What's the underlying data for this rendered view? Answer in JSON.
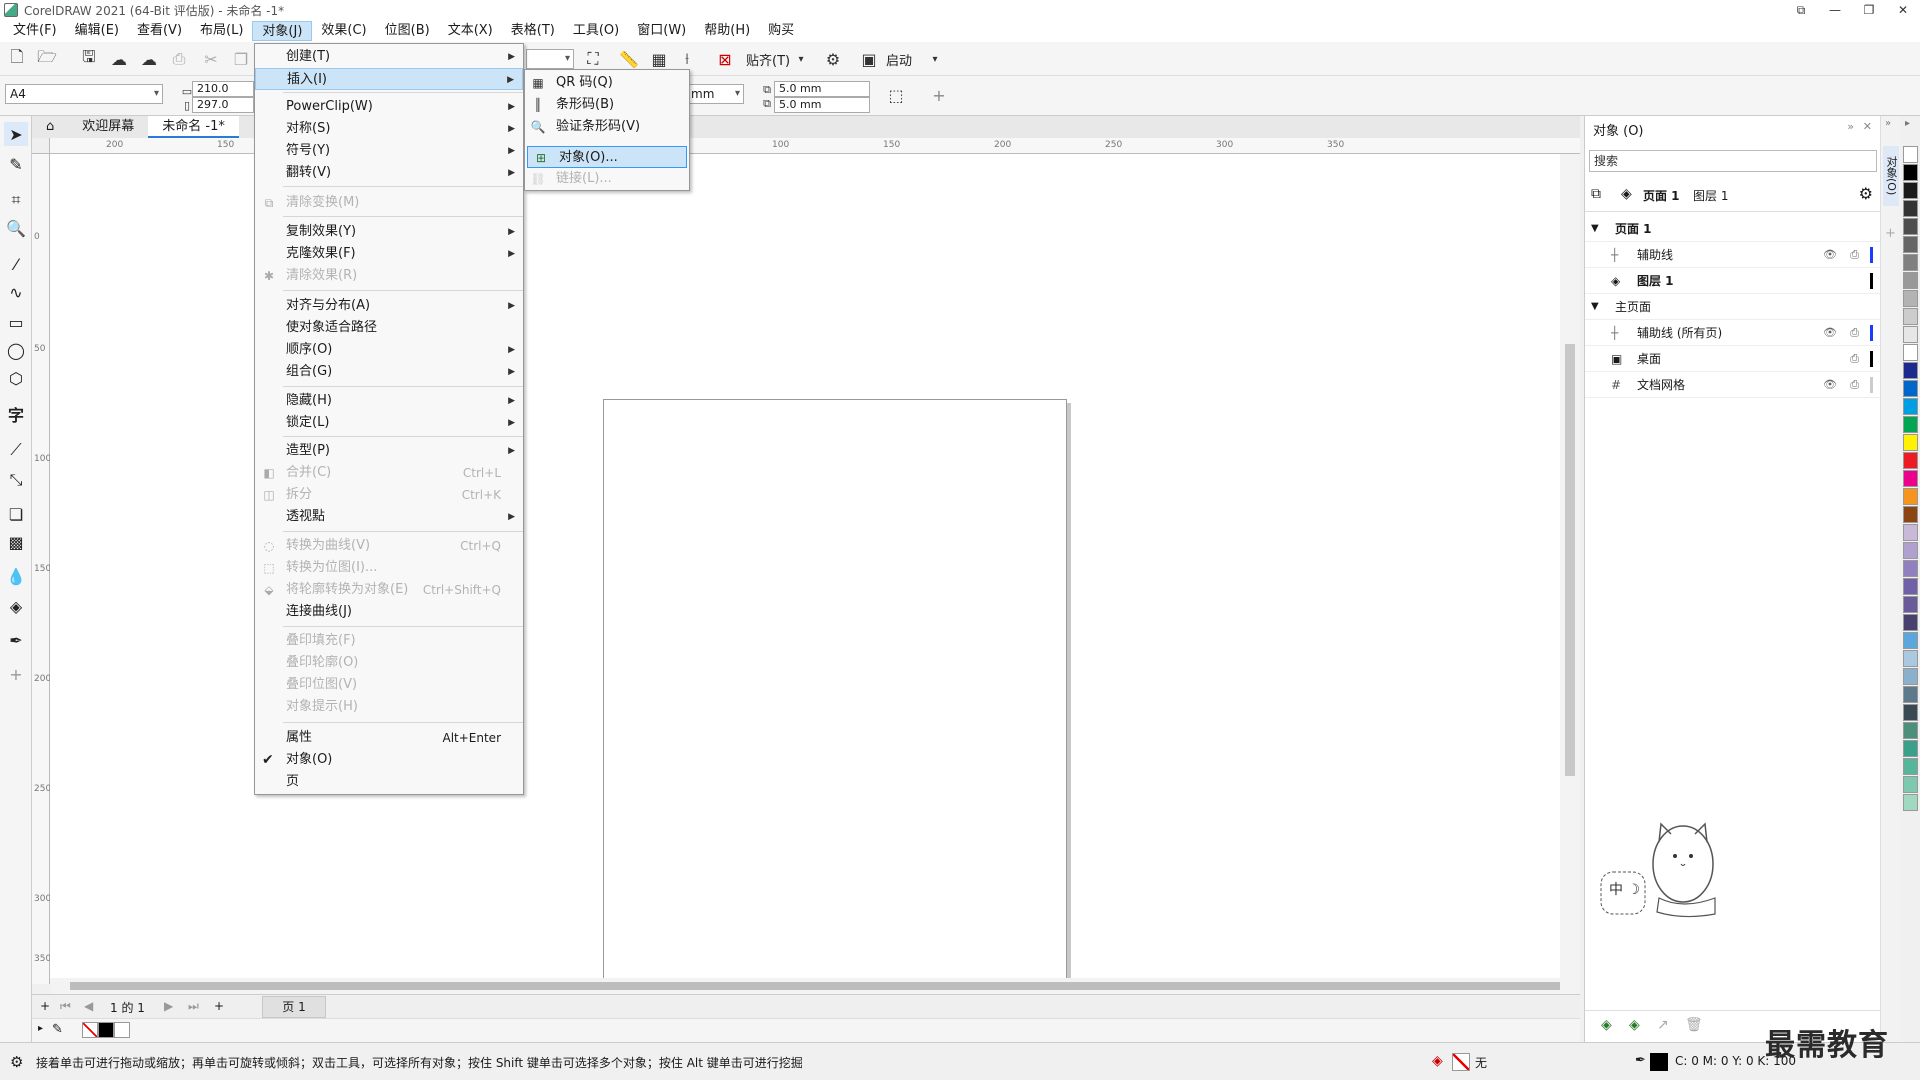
{
  "window": {
    "title": "CorelDRAW 2021 (64-Bit 评估版) - 未命名 -1*",
    "min": "—",
    "restore": "❐",
    "close": "✕",
    "help_ctl": "⧉"
  },
  "menubar": [
    {
      "label": "文件(F)"
    },
    {
      "label": "编辑(E)"
    },
    {
      "label": "查看(V)"
    },
    {
      "label": "布局(L)"
    },
    {
      "label": "对象(J)"
    },
    {
      "label": "效果(C)"
    },
    {
      "label": "位图(B)"
    },
    {
      "label": "文本(X)"
    },
    {
      "label": "表格(T)"
    },
    {
      "label": "工具(O)"
    },
    {
      "label": "窗口(W)"
    },
    {
      "label": "帮助(H)"
    },
    {
      "label": "购买"
    }
  ],
  "toolbar": {
    "snap_label": "贴齐(T)",
    "launch_label": "启动"
  },
  "propbar": {
    "page_size": "A4",
    "width": "210.0 mm",
    "height": "297.0 mm",
    "units": "mm",
    "dup_x": "5.0 mm",
    "dup_y": "5.0 mm"
  },
  "doctabs": {
    "welcome": "欢迎屏幕",
    "doc": "未命名 -1*"
  },
  "ruler": {
    "h_ticks": [
      "200",
      "150",
      "100",
      "150",
      "200",
      "250",
      "300",
      "350"
    ],
    "v_ticks": [
      "0",
      "50",
      "100",
      "150",
      "200",
      "250",
      "300",
      "350"
    ]
  },
  "object_menu": {
    "items": [
      {
        "label": "创建(T)",
        "sub": true
      },
      {
        "label": "插入(I)",
        "sub": true,
        "highlight": true
      },
      {
        "label": "PowerClip(W)",
        "sub": true
      },
      {
        "label": "对称(S)",
        "sub": true
      },
      {
        "label": "符号(Y)",
        "sub": true
      },
      {
        "label": "翻转(V)",
        "sub": true
      },
      {
        "label": "清除变换(M)",
        "disabled": true
      },
      {
        "label": "复制效果(Y)",
        "sub": true
      },
      {
        "label": "克隆效果(F)",
        "sub": true
      },
      {
        "label": "清除效果(R)",
        "disabled": true
      },
      {
        "label": "对齐与分布(A)",
        "sub": true
      },
      {
        "label": "使对象适合路径"
      },
      {
        "label": "顺序(O)",
        "sub": true
      },
      {
        "label": "组合(G)",
        "sub": true
      },
      {
        "label": "隐藏(H)",
        "sub": true
      },
      {
        "label": "锁定(L)",
        "sub": true
      },
      {
        "label": "造型(P)",
        "sub": true
      },
      {
        "label": "合并(C)",
        "shortcut": "Ctrl+L",
        "disabled": true
      },
      {
        "label": "拆分",
        "shortcut": "Ctrl+K",
        "disabled": true
      },
      {
        "label": "透视點",
        "sub": true
      },
      {
        "label": "转换为曲线(V)",
        "shortcut": "Ctrl+Q",
        "disabled": true
      },
      {
        "label": "转换为位图(I)...",
        "disabled": true
      },
      {
        "label": "将轮廓转换为对象(E)",
        "shortcut": "Ctrl+Shift+Q",
        "disabled": true
      },
      {
        "label": "连接曲线(J)"
      },
      {
        "label": "叠印填充(F)",
        "disabled": true
      },
      {
        "label": "叠印轮廓(O)",
        "disabled": true
      },
      {
        "label": "叠印位图(V)",
        "disabled": true
      },
      {
        "label": "对象提示(H)",
        "disabled": true
      },
      {
        "label": "属性",
        "shortcut": "Alt+Enter"
      },
      {
        "label": "对象(O)",
        "checked": true
      },
      {
        "label": "页"
      }
    ]
  },
  "insert_submenu": {
    "items": [
      {
        "label": "QR 码(Q)"
      },
      {
        "label": "条形码(B)"
      },
      {
        "label": "验证条形码(V)"
      },
      {
        "label": "对象(O)...",
        "highlight": true
      },
      {
        "label": "链接(L)...",
        "disabled": true
      }
    ]
  },
  "pagenav": {
    "page_of": "1 的 1",
    "page_tab": "页 1"
  },
  "statusbar": {
    "hint": "接着单击可进行拖动或缩放；再单击可旋转或倾斜；双击工具，可选择所有对象；按住 Shift 键单击可选择多个对象；按住 Alt 键单击可进行挖掘",
    "fill": "无",
    "cmyk": "C: 0 M: 0 Y: 0 K: 100"
  },
  "docker": {
    "title": "对象 (O)",
    "search_placeholder": "搜索",
    "page_label": "页面 1",
    "layer_label": "图层 1",
    "tree": [
      {
        "label": "页面 1",
        "bold": true
      },
      {
        "label": "辅助线",
        "color": "#1a3cff"
      },
      {
        "label": "图层 1",
        "bold": true,
        "color": "#000000"
      },
      {
        "label": "主页面"
      },
      {
        "label": "辅助线 (所有页)",
        "color": "#1a3cff"
      },
      {
        "label": "桌面",
        "color": "#000000"
      },
      {
        "label": "文档网格",
        "color": "#cccccc"
      }
    ],
    "vtab": "对象(O)",
    "mascot_text": "中 ☽"
  },
  "palette": [
    "#ffffff",
    "#000000",
    "#1a1a1a",
    "#333333",
    "#4d4d4d",
    "#666666",
    "#808080",
    "#999999",
    "#b3b3b3",
    "#cccccc",
    "#e6e6e6",
    "#ffffff",
    "#1b2a8c",
    "#0066cc",
    "#009fe3",
    "#00a651",
    "#fff200",
    "#ed1c24",
    "#ec008c",
    "#f7941d",
    "#8b4513",
    "#c9b8d8",
    "#b0a0d0",
    "#9080c0",
    "#7060a8",
    "#6a5a9a",
    "#4a4070",
    "#5ba6dd",
    "#aac8e0",
    "#8ab0cc",
    "#5d7a8c",
    "#3a4a55",
    "#4c8f7a",
    "#3aa08a",
    "#56b59a",
    "#7fc8b0",
    "#a0d8c0"
  ],
  "watermark": "最需教育"
}
